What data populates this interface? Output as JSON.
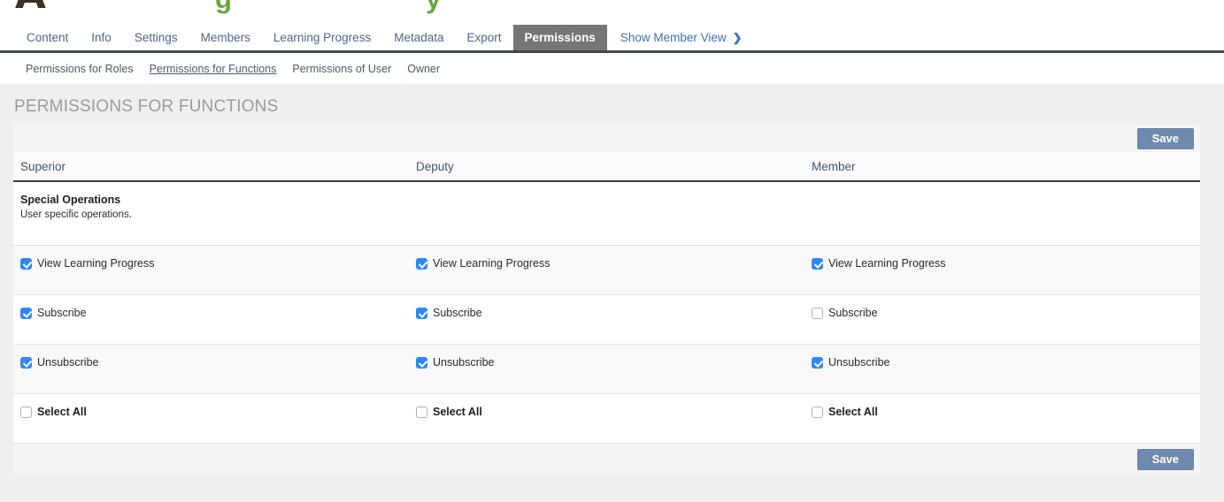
{
  "header": {
    "logo_fragment": "A",
    "title_fragments": {
      "f1": "g",
      "f2": "y"
    }
  },
  "tabs": {
    "items": [
      {
        "label": "Content"
      },
      {
        "label": "Info"
      },
      {
        "label": "Settings"
      },
      {
        "label": "Members"
      },
      {
        "label": "Learning Progress"
      },
      {
        "label": "Metadata"
      },
      {
        "label": "Export"
      },
      {
        "label": "Permissions"
      }
    ],
    "member_view": {
      "label": "Show Member View",
      "chevron": "❯"
    }
  },
  "subtabs": {
    "items": [
      {
        "label": "Permissions for Roles"
      },
      {
        "label": "Permissions for Functions"
      },
      {
        "label": "Permissions of User"
      },
      {
        "label": "Owner"
      }
    ]
  },
  "page": {
    "title": "PERMISSIONS FOR FUNCTIONS"
  },
  "toolbar": {
    "save_label": "Save"
  },
  "table": {
    "columns": [
      "Superior",
      "Deputy",
      "Member"
    ],
    "section": {
      "title": "Special Operations",
      "description": "User specific operations."
    },
    "rows": [
      {
        "label": "View Learning Progress",
        "checked": [
          true,
          true,
          true
        ]
      },
      {
        "label": "Subscribe",
        "checked": [
          true,
          true,
          false
        ]
      },
      {
        "label": "Unsubscribe",
        "checked": [
          true,
          true,
          true
        ]
      },
      {
        "label": "Select All",
        "checked": [
          false,
          false,
          false
        ]
      }
    ]
  },
  "colors": {
    "accent_checkbox": "#2f86f6",
    "save_button": "#7089ae",
    "active_tab_bg": "#767676",
    "tab_text": "#4f6787",
    "member_view_link": "#3a72b8",
    "title_green": "#68a63f",
    "page_background": "#efefef",
    "heading_gray": "#9c9c9c"
  }
}
